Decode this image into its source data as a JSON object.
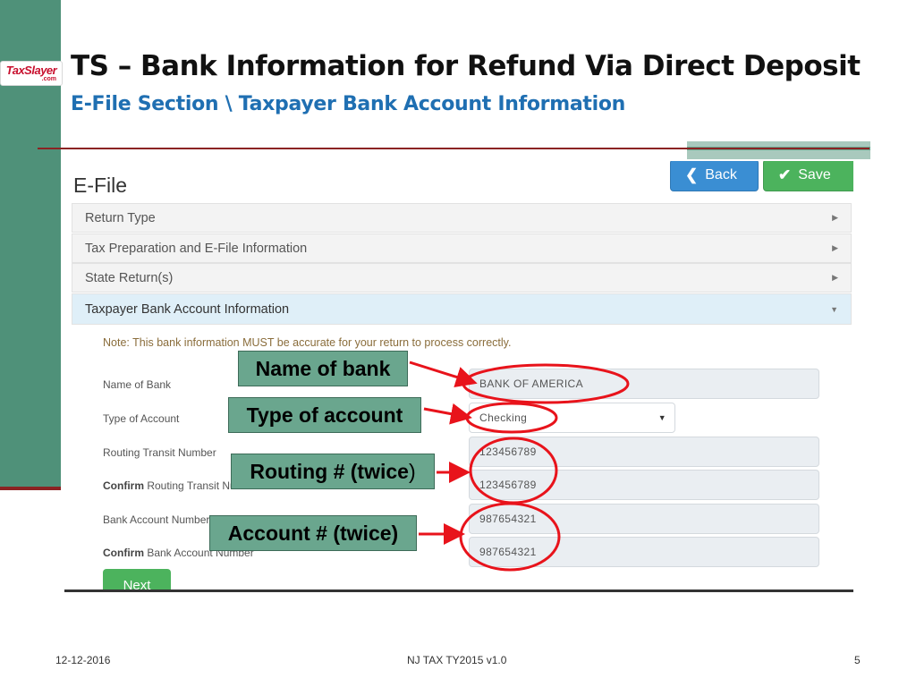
{
  "slide": {
    "title": "TS – Bank Information for Refund Via Direct Deposit",
    "subtitle": "E-File Section \\ Taxpayer Bank Account Information",
    "logo_main": "TaxSlayer",
    "logo_sub": ".com",
    "footer_date": "12-12-2016",
    "footer_center": "NJ TAX TY2015 v1.0",
    "page_number": "5"
  },
  "app": {
    "heading": "E-File",
    "back_label": "Back",
    "save_label": "Save",
    "back_icon": "chevron-left-icon",
    "save_icon": "checkmark-icon",
    "sections": [
      {
        "label": "Return Type"
      },
      {
        "label": "Tax Preparation and E-File Information"
      },
      {
        "label": "State Return(s)"
      },
      {
        "label": "Taxpayer Bank Account Information"
      }
    ],
    "note": "Note: This bank information MUST be accurate for your return to process correctly.",
    "form": {
      "bank_name_label": "Name of Bank",
      "bank_name_value": "BANK OF AMERICA",
      "account_type_label": "Type of Account",
      "account_type_value": "Checking",
      "routing_label": "Routing Transit Number",
      "routing_value": "123456789",
      "confirm_word": "Confirm",
      "confirm_routing_label": " Routing Transit Number",
      "confirm_routing_value": "123456789",
      "account_label": "Bank Account Number",
      "account_value": "987654321",
      "confirm_account_label": " Bank Account Number",
      "confirm_account_value": "987654321"
    },
    "next_label": "Next"
  },
  "callouts": {
    "bank": "Name of bank",
    "type": "Type of account",
    "routing_main": "Routing # (twice",
    "routing_close": ")",
    "account": "Account # (twice)"
  },
  "colors": {
    "callout_fill": "#6aa68e",
    "arrow": "#e8131b",
    "primary_button": "#3a8ed3",
    "success_button": "#4cb35d",
    "accent_bar": "#4f9179"
  }
}
